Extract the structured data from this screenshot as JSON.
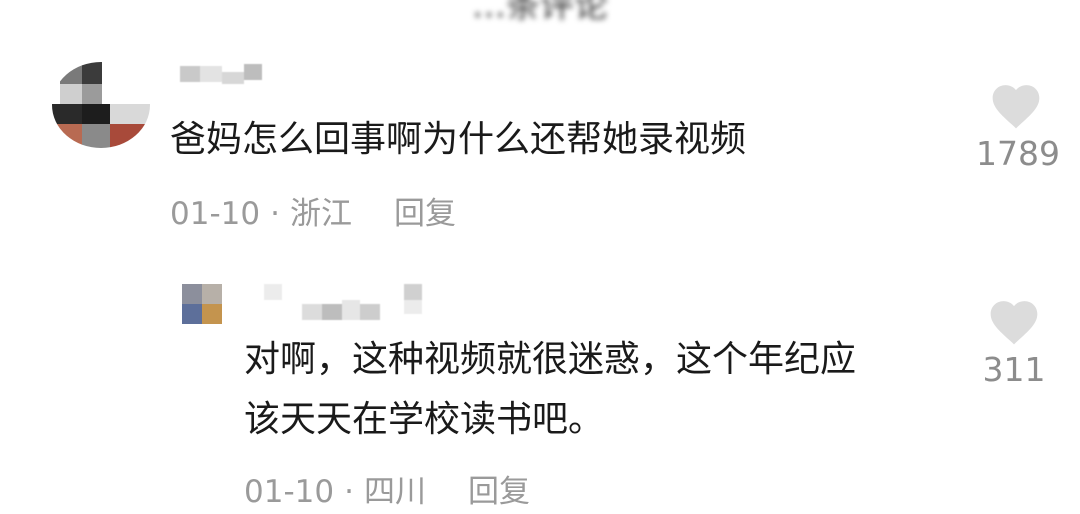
{
  "header": {
    "title": "…条评论"
  },
  "comments": [
    {
      "text": "爸妈怎么回事啊为什么还帮她录视频",
      "date": "01-10",
      "location": "浙江",
      "reply_label": "回复",
      "likes": "1789",
      "like_icon": "heart-icon"
    }
  ],
  "replies": [
    {
      "text_line1": "对啊，这种视频就很迷惑，这个年纪应",
      "text_line2": "该天天在学校读书吧。",
      "date": "01-10",
      "location": "四川",
      "reply_label": "回复",
      "likes": "311",
      "like_icon": "heart-icon"
    }
  ],
  "meta_separator": "·",
  "colors": {
    "meta_text": "#9a9a9a",
    "heart": "#dcdcdc",
    "body_text": "#1a1a1a"
  }
}
